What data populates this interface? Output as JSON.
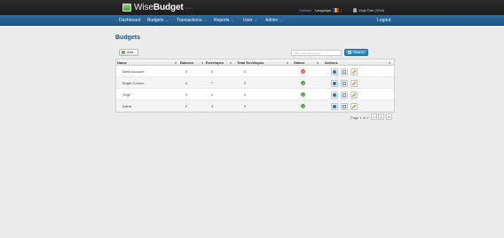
{
  "header": {
    "brand_light": "Wise",
    "brand_bold": "Budget",
    "brand_tagline": "demo version",
    "contact_label": "Contact",
    "language_label": "Language",
    "username": "Virgil Dan (VDA)"
  },
  "nav": {
    "items": [
      {
        "label": "Dashboard",
        "has_menu": false
      },
      {
        "label": "Budgets",
        "has_menu": true
      },
      {
        "label": "Transactions",
        "has_menu": true
      },
      {
        "label": "Reports",
        "has_menu": true
      },
      {
        "label": "User",
        "has_menu": true
      },
      {
        "label": "Admin",
        "has_menu": true
      }
    ],
    "caret": "⌄",
    "logout_label": "Logout"
  },
  "page": {
    "title": "Budgets",
    "add_label": "Add",
    "search_placeholder": "Write your criteria here",
    "search_label": "Search"
  },
  "table": {
    "columns": [
      "Name",
      "Balance",
      "Envelopes",
      "Total Envelopes",
      "Status",
      "Actions"
    ],
    "sort_glyph": "♦",
    "rows": [
      {
        "name": "Bank Account",
        "balance": "0",
        "envelopes": "5",
        "total_envelopes": "0",
        "status": "inactive",
        "status_glyph": "✕"
      },
      {
        "name": "Buget Comun",
        "balance": "0",
        "envelopes": "7",
        "total_envelopes": "0",
        "status": "active",
        "status_glyph": "–"
      },
      {
        "name": "Virgil",
        "balance": "0",
        "envelopes": "4",
        "total_envelopes": "0",
        "status": "active",
        "status_glyph": "–"
      },
      {
        "name": "Ioana",
        "balance": "0",
        "envelopes": "4",
        "total_envelopes": "0",
        "status": "active",
        "status_glyph": "–"
      }
    ],
    "actions": [
      "info-icon",
      "mail-icon",
      "edit-icon"
    ]
  },
  "pagination": {
    "label": "Page 1 of 1",
    "prev": "«",
    "current": "1",
    "next": "»"
  },
  "colors": {
    "nav_blue": "#1f5484",
    "status_active": "#52a844",
    "status_inactive": "#d64040",
    "brand_tagline": "#d23d3d"
  }
}
